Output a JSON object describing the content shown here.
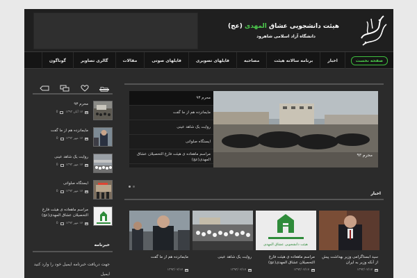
{
  "header": {
    "title_part1": "هیئت دانشجویی عشاق",
    "title_highlight": "المهدی",
    "title_part2": "(عج)",
    "subtitle": "دانشگاه آزاد اسلامی شاهرود"
  },
  "nav": {
    "items": [
      {
        "label": "صفحه نخست",
        "active": true
      },
      {
        "label": "اخبار"
      },
      {
        "label": "برنامه سالانه هیئت"
      },
      {
        "label": "مصاحبه"
      },
      {
        "label": "فایلهای تصویری"
      },
      {
        "label": "فایلهای صوتی"
      },
      {
        "label": "مقالات"
      },
      {
        "label": "گالری تصاویر"
      },
      {
        "label": "گوناگون"
      }
    ]
  },
  "sidebar": {
    "tabs": [
      "folder-icon",
      "heart-icon",
      "comments-icon",
      "tag-icon"
    ],
    "items": [
      {
        "title": "محرم ۹۳",
        "date": "۱۷ آبان ۱۳۹۳",
        "comments": "0"
      },
      {
        "title": "مایمانزده هم از ما گفت",
        "date": "۱۷ مهر ۱۳۹۳",
        "comments": "0"
      },
      {
        "title": "روایت یک شاهد عینی",
        "date": "۱۷ مهر ۱۳۹۳",
        "comments": "0"
      },
      {
        "title": "ایستگاه صلواتی",
        "date": "۱۷ مهر ۱۳۹۳",
        "comments": "0"
      },
      {
        "title": "مراسم ماهعاده ی هیئت فارغ التحصیلان عشاق المهدی(عج)",
        "date": "۱۷ مهر ۱۳۹۳",
        "comments": "0"
      }
    ],
    "newsletter_heading": "خبرنامه",
    "newsletter_text": "جهت دریافت خبرنامه ایمیل خود را وارد کنید",
    "newsletter_text2": "ایمیل"
  },
  "slider": {
    "items": [
      "محرم ۹۳",
      "مایمانزده هم از ما گفت",
      "روایت یک شاهد عینی",
      "ایستگاه صلواتی",
      "مراسم ماهعاده ی هیئت فارغ التحصیلان عشاق المهدی(عج)"
    ],
    "caption": "محرم ۹۳"
  },
  "news": {
    "heading": "اخبار",
    "cards": [
      {
        "title": "سید ابستاگرامی وزیر بهداشت پیش از آنکه وزیر به ایران",
        "date": "۱۳۹۳/۰۲/۱۷"
      },
      {
        "title": "مراسم ماهعاده ی هیئت فارغ التحصیلان عشاق المهدی(عج)",
        "date": "۱۳۹۳/۰۲/۱۷"
      },
      {
        "title": "روایت یک شاهد عینی",
        "date": "۱۳۹۳/۰۲/۱۷"
      },
      {
        "title": "مایمانزده هم از ما گفت",
        "date": "۱۳۹۳/۰۲/۱۷"
      }
    ],
    "card4_logo_text": "هیئت دانشجویی عشاق المهدی"
  }
}
